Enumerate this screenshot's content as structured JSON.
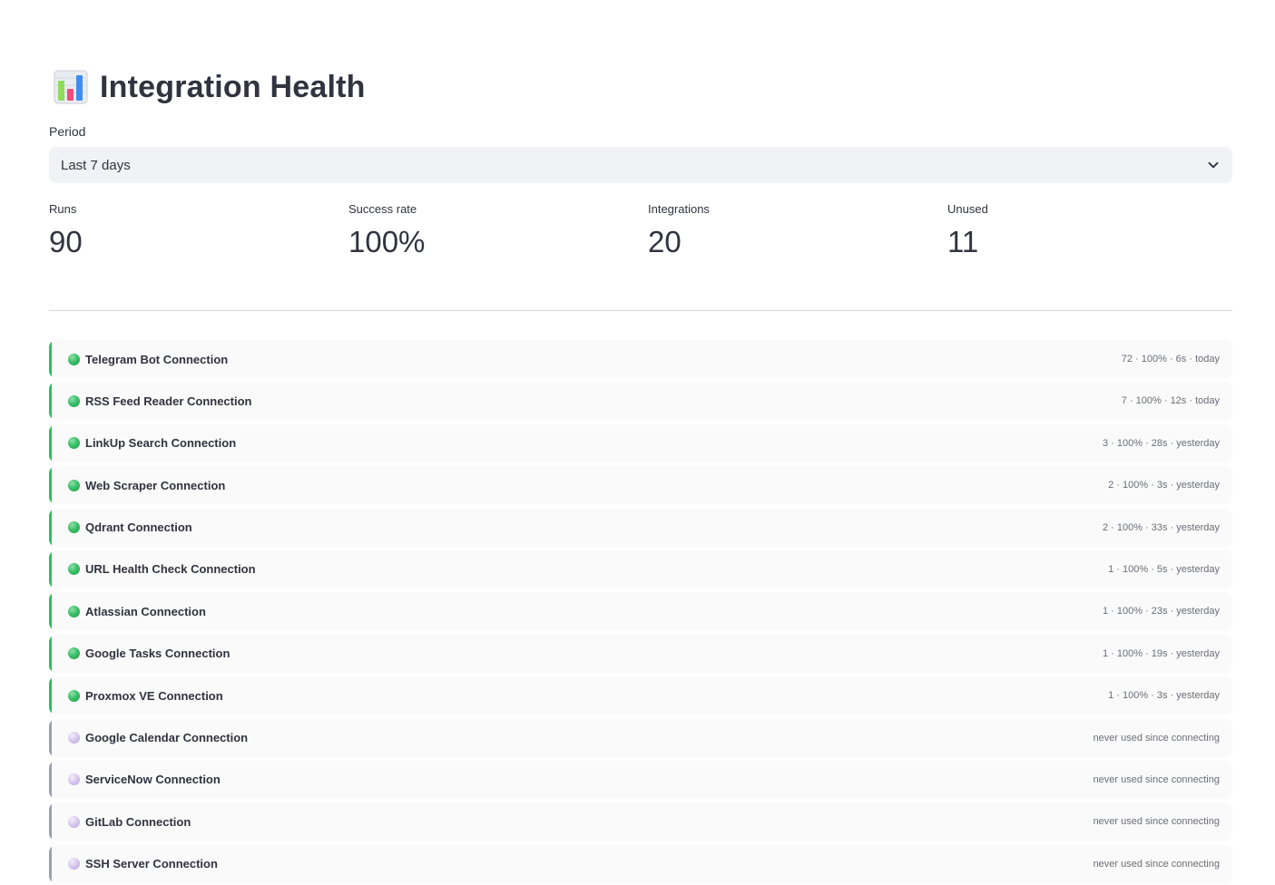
{
  "header": {
    "title": "Integration Health",
    "icon": "bar-chart-icon"
  },
  "period": {
    "label": "Period",
    "selected": "Last 7 days"
  },
  "metrics": [
    {
      "label": "Runs",
      "value": "90"
    },
    {
      "label": "Success rate",
      "value": "100%"
    },
    {
      "label": "Integrations",
      "value": "20"
    },
    {
      "label": "Unused",
      "value": "11"
    }
  ],
  "colors": {
    "active_accent": "#27c25a",
    "unused_accent": "#9ca0ad",
    "select_bg": "#f0f2f6",
    "row_bg": "#fafafa"
  },
  "integrations": [
    {
      "name": "Telegram Bot Connection",
      "meta": "72 · 100% · 6s · today",
      "status": "active"
    },
    {
      "name": "RSS Feed Reader Connection",
      "meta": "7 · 100% · 12s · today",
      "status": "active"
    },
    {
      "name": "LinkUp Search Connection",
      "meta": "3 · 100% · 28s · yesterday",
      "status": "active"
    },
    {
      "name": "Web Scraper Connection",
      "meta": "2 · 100% · 3s · yesterday",
      "status": "active"
    },
    {
      "name": "Qdrant Connection",
      "meta": "2 · 100% · 33s · yesterday",
      "status": "active"
    },
    {
      "name": "URL Health Check Connection",
      "meta": "1 · 100% · 5s · yesterday",
      "status": "active"
    },
    {
      "name": "Atlassian Connection",
      "meta": "1 · 100% · 23s · yesterday",
      "status": "active"
    },
    {
      "name": "Google Tasks Connection",
      "meta": "1 · 100% · 19s · yesterday",
      "status": "active"
    },
    {
      "name": "Proxmox VE Connection",
      "meta": "1 · 100% · 3s · yesterday",
      "status": "active"
    },
    {
      "name": "Google Calendar Connection",
      "meta": "never used since connecting",
      "status": "unused"
    },
    {
      "name": "ServiceNow Connection",
      "meta": "never used since connecting",
      "status": "unused"
    },
    {
      "name": "GitLab Connection",
      "meta": "never used since connecting",
      "status": "unused"
    },
    {
      "name": "SSH Server Connection",
      "meta": "never used since connecting",
      "status": "unused"
    }
  ]
}
